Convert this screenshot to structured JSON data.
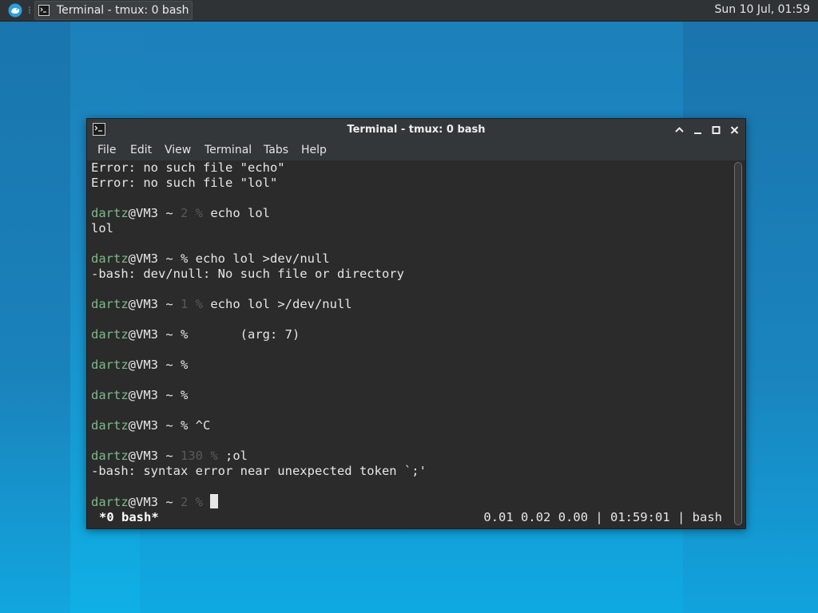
{
  "panel": {
    "task_label": "Terminal - tmux: 0 bash",
    "clock": "Sun 10 Jul, 01:59"
  },
  "window": {
    "title": "Terminal - tmux: 0 bash",
    "menu": [
      "File",
      "Edit",
      "View",
      "Terminal",
      "Tabs",
      "Help"
    ]
  },
  "terminal": {
    "user": "dartz",
    "host_path": "@VM3 ~ ",
    "lines": [
      {
        "kind": "text",
        "text": "Error: no such file \"echo\""
      },
      {
        "kind": "text",
        "text": "Error: no such file \"lol\""
      },
      {
        "kind": "blank"
      },
      {
        "kind": "prompt",
        "code": "2 %",
        "cmd": " echo lol"
      },
      {
        "kind": "text",
        "text": "lol"
      },
      {
        "kind": "blank"
      },
      {
        "kind": "prompt",
        "code": "%",
        "cmd": " echo lol >dev/null",
        "bright": true
      },
      {
        "kind": "text",
        "text": "-bash: dev/null: No such file or directory"
      },
      {
        "kind": "blank"
      },
      {
        "kind": "prompt",
        "code": "1 %",
        "cmd": " echo lol >/dev/null"
      },
      {
        "kind": "blank"
      },
      {
        "kind": "prompt",
        "code": "%",
        "cmd": "       (arg: 7)",
        "bright": true
      },
      {
        "kind": "blank"
      },
      {
        "kind": "prompt",
        "code": "%",
        "cmd": "",
        "bright": true
      },
      {
        "kind": "blank"
      },
      {
        "kind": "prompt",
        "code": "%",
        "cmd": "",
        "bright": true
      },
      {
        "kind": "blank"
      },
      {
        "kind": "prompt",
        "code": "%",
        "cmd": " ^C",
        "bright": true
      },
      {
        "kind": "blank"
      },
      {
        "kind": "prompt",
        "code": "130 %",
        "cmd": " ;ol"
      },
      {
        "kind": "text",
        "text": "-bash: syntax error near unexpected token `;'"
      },
      {
        "kind": "blank"
      },
      {
        "kind": "prompt",
        "code": "2 %",
        "cmd": " ",
        "cursor": true
      }
    ],
    "status_left": "*0 bash*",
    "status_right": "0.01 0.02 0.00 | 01:59:01 | bash"
  },
  "colors": {
    "prompt_user": "#7fb88b",
    "dim_code": "#595959",
    "terminal_bg": "#2b2b2b"
  }
}
